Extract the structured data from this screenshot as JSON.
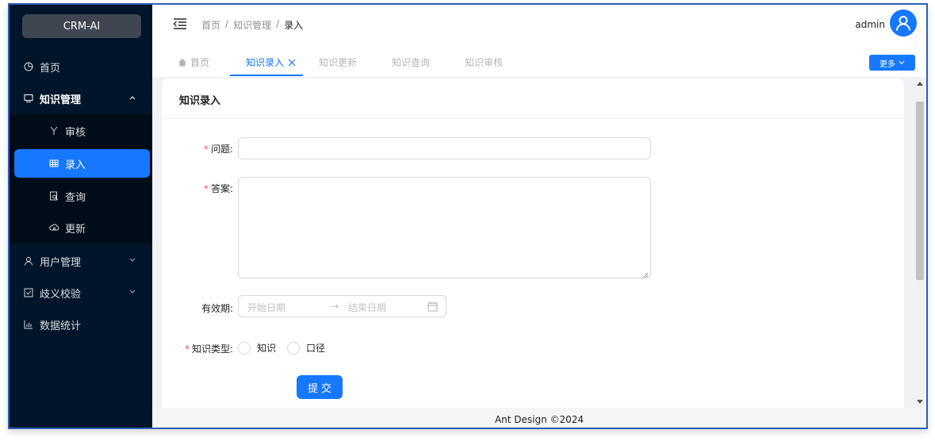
{
  "app": {
    "logo": "CRM-AI"
  },
  "sidebar": {
    "items": [
      {
        "label": "首页",
        "icon": "pie-chart-icon"
      },
      {
        "label": "知识管理",
        "icon": "desktop-icon",
        "expanded": true
      },
      {
        "label": "审核",
        "icon": "fork-icon"
      },
      {
        "label": "录入",
        "icon": "table-icon",
        "selected": true
      },
      {
        "label": "查询",
        "icon": "file-search-icon"
      },
      {
        "label": "更新",
        "icon": "cloud-sync-icon"
      },
      {
        "label": "用户管理",
        "icon": "user-icon"
      },
      {
        "label": "歧义校验",
        "icon": "check-square-icon"
      },
      {
        "label": "数据统计",
        "icon": "bar-chart-icon"
      }
    ]
  },
  "header": {
    "breadcrumb": [
      "首页",
      "/",
      "知识管理",
      "/",
      "录入"
    ],
    "username": "admin"
  },
  "tabs": {
    "items": [
      {
        "label": "首页",
        "icon": "home-icon"
      },
      {
        "label": "知识录入",
        "active": true,
        "closable": true
      },
      {
        "label": "知识更新"
      },
      {
        "label": "知识查询"
      },
      {
        "label": "知识审核"
      }
    ],
    "more_label": "更多"
  },
  "form": {
    "title": "知识录入",
    "question": {
      "required_mark": "*",
      "label": "问题:",
      "value": ""
    },
    "answer": {
      "required_mark": "*",
      "label": "答案:",
      "value": ""
    },
    "validity": {
      "label": "有效期:",
      "start_placeholder": "开始日期",
      "arrow": "→",
      "end_placeholder": "结束日期"
    },
    "type": {
      "required_mark": "*",
      "label": "知识类型:",
      "options": [
        "知识",
        "口径"
      ]
    },
    "submit_label": "提交"
  },
  "footer": {
    "text": "Ant Design ©2024"
  },
  "colors": {
    "primary": "#1677ff",
    "sider": "#001529",
    "submenu": "#000c17",
    "required": "#ff4d4f"
  }
}
